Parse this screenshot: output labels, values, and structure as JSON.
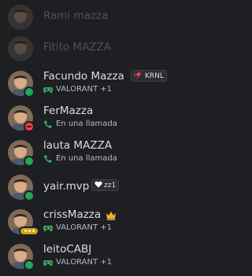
{
  "colors": {
    "background": "#1e1f22",
    "online": "#23a55a",
    "dnd": "#f23f43",
    "idle_badge": "#d4a017",
    "game_icon": "#3ba55c",
    "crown": "#f0b132"
  },
  "members": [
    {
      "name": "Rami mazza",
      "status": "offline"
    },
    {
      "name": "Fitito MAZZA",
      "status": "offline"
    },
    {
      "name": "Facundo Mazza",
      "status": "online",
      "tag": "KRNL",
      "tag_icon": "lightning-icon",
      "activity": "VALORANT +1",
      "activity_icon": "gamepad-icon"
    },
    {
      "name": "FerMazza",
      "status": "dnd",
      "activity": "En una llamada",
      "activity_icon": "phone-icon"
    },
    {
      "name": "lauta MAZZA",
      "status": "online",
      "activity": "En una llamada",
      "activity_icon": "phone-icon"
    },
    {
      "name": "yair.mvp",
      "status": "online",
      "tag": "zz1",
      "tag_icon": "heart-icon"
    },
    {
      "name": "crissMazza",
      "status": "mobile-typing",
      "badge": "crown-icon",
      "activity": "VALORANT +1",
      "activity_icon": "gamepad-icon"
    },
    {
      "name": "leitoCABJ",
      "status": "online",
      "activity": "VALORANT +1",
      "activity_icon": "gamepad-icon"
    }
  ]
}
